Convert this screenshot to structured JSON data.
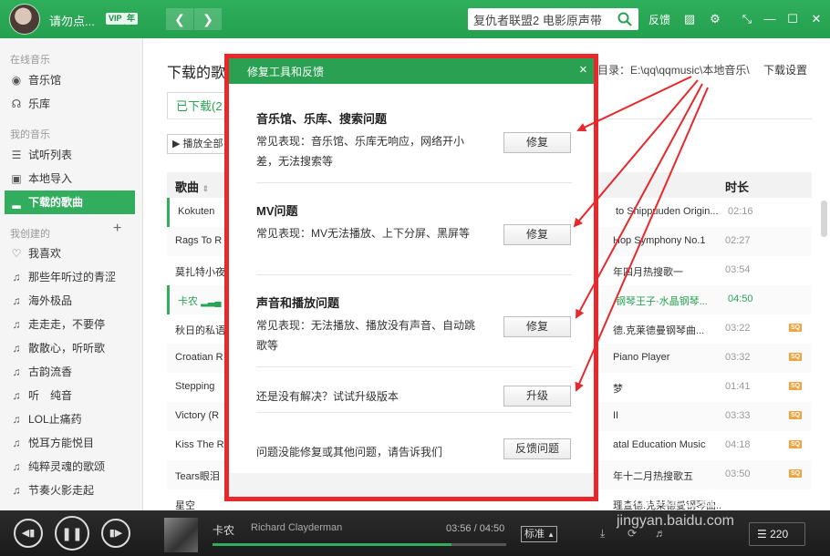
{
  "topbar": {
    "username": "请勿点...",
    "badges": [
      "VIP",
      "年"
    ],
    "search_value": "复仇者联盟2 电影原声带",
    "feedback": "反馈",
    "icons": [
      "shirt-icon",
      "gear-icon",
      "mini-mode-icon",
      "minimize-icon",
      "maximize-icon",
      "close-icon"
    ]
  },
  "sidebar": {
    "online_label": "在线音乐",
    "online_items": [
      {
        "label": "音乐馆",
        "icon": "music-hall-icon"
      },
      {
        "label": "乐库",
        "icon": "headphones-icon"
      }
    ],
    "my_label": "我的音乐",
    "my_items": [
      {
        "label": "试听列表",
        "icon": "list-icon"
      },
      {
        "label": "本地导入",
        "icon": "monitor-icon"
      },
      {
        "label": "下载的歌曲",
        "icon": "download-bars-icon"
      }
    ],
    "created_label": "我创建的",
    "created_items": [
      {
        "label": "我喜欢",
        "icon": "heart-icon"
      },
      {
        "label": "那些年听过的青涩",
        "icon": "note-icon"
      },
      {
        "label": "海外极品",
        "icon": "note-icon"
      },
      {
        "label": "走走走，不要停",
        "icon": "note-icon"
      },
      {
        "label": "散散心，听听歌",
        "icon": "note-icon"
      },
      {
        "label": "古韵流香",
        "icon": "note-icon"
      },
      {
        "label": "听　纯音",
        "icon": "note-icon"
      },
      {
        "label": "LOL止痛药",
        "icon": "note-icon"
      },
      {
        "label": "悦耳方能悦目",
        "icon": "note-icon"
      },
      {
        "label": "纯粹灵魂的歌颂",
        "icon": "note-icon"
      },
      {
        "label": "节奏火影走起",
        "icon": "note-icon"
      }
    ]
  },
  "main": {
    "title": "下载的歌",
    "dir": "目录：E:\\qq\\qqmusic\\本地音乐\\",
    "settings": "下载设置",
    "tab_downloaded": "已下载(2",
    "play_all": "播放全部",
    "col_song": "歌曲",
    "col_album": "",
    "col_duration": "时长",
    "rows": [
      {
        "song": "Kokuten",
        "album": "to Shippuuden Origin...",
        "duration": "02:16",
        "sq": false
      },
      {
        "song": "Rags To R",
        "album": "Hop Symphony No.1",
        "duration": "02:27",
        "sq": false
      },
      {
        "song": "莫扎特小夜",
        "album": "年四月热搜歌一",
        "duration": "03:54",
        "sq": false
      },
      {
        "song": "卡农",
        "album": "钢琴王子·水晶钢琴...",
        "duration": "04:50",
        "sq": false
      },
      {
        "song": "秋日的私语",
        "album": "德.克莱德曼钢琴曲...",
        "duration": "03:22",
        "sq": true
      },
      {
        "song": "Croatian R",
        "album": "Piano Player",
        "duration": "03:32",
        "sq": true
      },
      {
        "song": "Stepping",
        "album": "梦",
        "duration": "01:41",
        "sq": true
      },
      {
        "song": "Victory (R",
        "album": "II",
        "duration": "03:33",
        "sq": true
      },
      {
        "song": "Kiss The R",
        "album": "atal Education Music",
        "duration": "04:18",
        "sq": true
      },
      {
        "song": "Tears眼泪",
        "album": "年十二月热搜歌五",
        "duration": "03:50",
        "sq": true
      },
      {
        "song": "星空",
        "album": "理查德.克莱德曼钢琴曲...",
        "duration": "",
        "sq": false
      }
    ],
    "sq_label": "SQ"
  },
  "player": {
    "title": "卡农",
    "artist": "Richard Clayderman",
    "time": "03:56 / 04:50",
    "progress": 0.814,
    "quality": "标准",
    "playlist_count": "220"
  },
  "modal": {
    "title": "修复工具和反馈",
    "close": "×",
    "issues": [
      {
        "title": "音乐馆、乐库、搜索问题",
        "desc": "常见表现：音乐馆、乐库无响应，网络开小差，无法搜索等",
        "button": "修复"
      },
      {
        "title": "MV问题",
        "desc": "常见表现：MV无法播放、上下分屏、黑屏等",
        "button": "修复"
      },
      {
        "title": "声音和播放问题",
        "desc": "常见表现：无法播放、播放没有声音、自动跳歌等",
        "button": "修复"
      }
    ],
    "upgrade_text": "还是没有解决？试试升级版本",
    "upgrade_button": "升级",
    "feedback_text": "问题没能修复或其他问题，请告诉我们",
    "feedback_button": "反馈问题"
  },
  "watermark": {
    "line1": "Baidu经验",
    "line2": "jingyan.baidu.com"
  }
}
